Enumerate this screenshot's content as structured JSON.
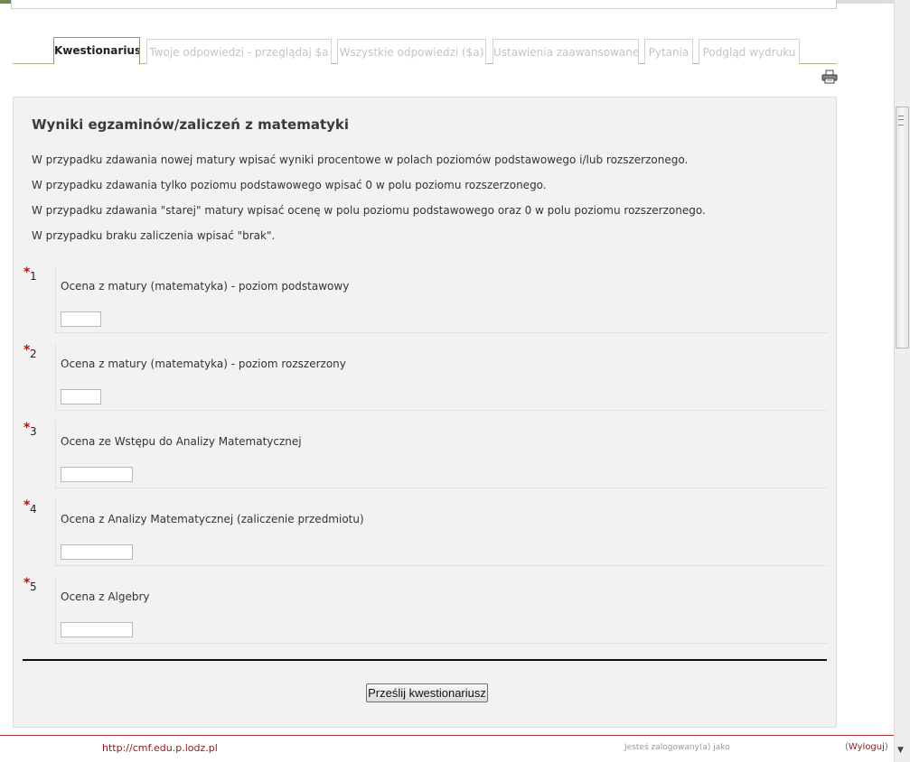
{
  "tabs": [
    {
      "label": "Kwestionariusz",
      "active": true
    },
    {
      "label": "Twoje odpowiedzi - przeglądaj $a",
      "active": false
    },
    {
      "label": "Wszystkie odpowiedzi ($a)",
      "active": false
    },
    {
      "label": "Ustawienia zaawansowane",
      "active": false
    },
    {
      "label": "Pytania",
      "active": false
    },
    {
      "label": "Podgląd wydruku",
      "active": false
    }
  ],
  "print_icon": "printer-icon",
  "form": {
    "title": "Wyniki egzaminów/zaliczeń z matematyki",
    "intro": [
      "W przypadku zdawania nowej matury wpisać wyniki procentowe w polach poziomów podstawowego i/lub rozszerzonego.",
      "W przypadku zdawania tylko poziomu podstawowego wpisać 0 w polu poziomu rozszerzonego.",
      "W przypadku zdawania \"starej\" matury wpisać ocenę w polu poziomu podstawowego oraz 0 w polu poziomu rozszerzonego.",
      "W przypadku braku zaliczenia wpisać \"brak\"."
    ],
    "required_mark": "*",
    "questions": [
      {
        "number": "1",
        "label": "Ocena z matury (matematyka) - poziom podstawowy",
        "value": ""
      },
      {
        "number": "2",
        "label": "Ocena z matury (matematyka) - poziom rozszerzony",
        "value": ""
      },
      {
        "number": "3",
        "label": "Ocena ze Wstępu do Analizy Matematycznej",
        "value": ""
      },
      {
        "number": "4",
        "label": "Ocena z Analizy Matematycznej (zaliczenie przedmiotu)",
        "value": ""
      },
      {
        "number": "5",
        "label": "Ocena z Algebry",
        "value": ""
      }
    ],
    "submit_label": "Prześlij kwestionariusz"
  },
  "footer": {
    "link": "http://cmf.edu.p.lodz.pl",
    "login_text": "Jesteś zalogowany(a) jako",
    "logout_open": "(",
    "logout_label": "Wyloguj",
    "logout_close": ")"
  }
}
